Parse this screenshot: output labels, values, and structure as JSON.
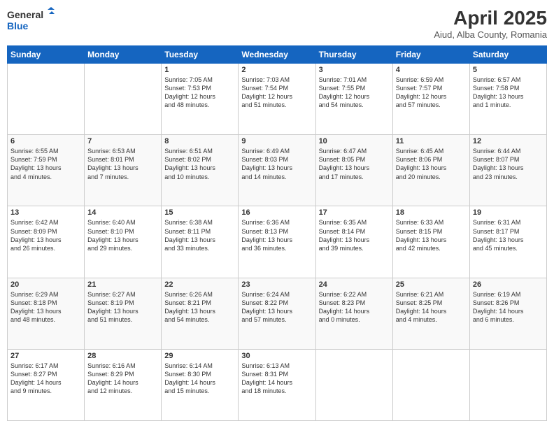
{
  "header": {
    "logo_line1": "General",
    "logo_line2": "Blue",
    "month": "April 2025",
    "location": "Aiud, Alba County, Romania"
  },
  "weekdays": [
    "Sunday",
    "Monday",
    "Tuesday",
    "Wednesday",
    "Thursday",
    "Friday",
    "Saturday"
  ],
  "weeks": [
    [
      {
        "day": "",
        "info": ""
      },
      {
        "day": "",
        "info": ""
      },
      {
        "day": "1",
        "info": "Sunrise: 7:05 AM\nSunset: 7:53 PM\nDaylight: 12 hours\nand 48 minutes."
      },
      {
        "day": "2",
        "info": "Sunrise: 7:03 AM\nSunset: 7:54 PM\nDaylight: 12 hours\nand 51 minutes."
      },
      {
        "day": "3",
        "info": "Sunrise: 7:01 AM\nSunset: 7:55 PM\nDaylight: 12 hours\nand 54 minutes."
      },
      {
        "day": "4",
        "info": "Sunrise: 6:59 AM\nSunset: 7:57 PM\nDaylight: 12 hours\nand 57 minutes."
      },
      {
        "day": "5",
        "info": "Sunrise: 6:57 AM\nSunset: 7:58 PM\nDaylight: 13 hours\nand 1 minute."
      }
    ],
    [
      {
        "day": "6",
        "info": "Sunrise: 6:55 AM\nSunset: 7:59 PM\nDaylight: 13 hours\nand 4 minutes."
      },
      {
        "day": "7",
        "info": "Sunrise: 6:53 AM\nSunset: 8:01 PM\nDaylight: 13 hours\nand 7 minutes."
      },
      {
        "day": "8",
        "info": "Sunrise: 6:51 AM\nSunset: 8:02 PM\nDaylight: 13 hours\nand 10 minutes."
      },
      {
        "day": "9",
        "info": "Sunrise: 6:49 AM\nSunset: 8:03 PM\nDaylight: 13 hours\nand 14 minutes."
      },
      {
        "day": "10",
        "info": "Sunrise: 6:47 AM\nSunset: 8:05 PM\nDaylight: 13 hours\nand 17 minutes."
      },
      {
        "day": "11",
        "info": "Sunrise: 6:45 AM\nSunset: 8:06 PM\nDaylight: 13 hours\nand 20 minutes."
      },
      {
        "day": "12",
        "info": "Sunrise: 6:44 AM\nSunset: 8:07 PM\nDaylight: 13 hours\nand 23 minutes."
      }
    ],
    [
      {
        "day": "13",
        "info": "Sunrise: 6:42 AM\nSunset: 8:09 PM\nDaylight: 13 hours\nand 26 minutes."
      },
      {
        "day": "14",
        "info": "Sunrise: 6:40 AM\nSunset: 8:10 PM\nDaylight: 13 hours\nand 29 minutes."
      },
      {
        "day": "15",
        "info": "Sunrise: 6:38 AM\nSunset: 8:11 PM\nDaylight: 13 hours\nand 33 minutes."
      },
      {
        "day": "16",
        "info": "Sunrise: 6:36 AM\nSunset: 8:13 PM\nDaylight: 13 hours\nand 36 minutes."
      },
      {
        "day": "17",
        "info": "Sunrise: 6:35 AM\nSunset: 8:14 PM\nDaylight: 13 hours\nand 39 minutes."
      },
      {
        "day": "18",
        "info": "Sunrise: 6:33 AM\nSunset: 8:15 PM\nDaylight: 13 hours\nand 42 minutes."
      },
      {
        "day": "19",
        "info": "Sunrise: 6:31 AM\nSunset: 8:17 PM\nDaylight: 13 hours\nand 45 minutes."
      }
    ],
    [
      {
        "day": "20",
        "info": "Sunrise: 6:29 AM\nSunset: 8:18 PM\nDaylight: 13 hours\nand 48 minutes."
      },
      {
        "day": "21",
        "info": "Sunrise: 6:27 AM\nSunset: 8:19 PM\nDaylight: 13 hours\nand 51 minutes."
      },
      {
        "day": "22",
        "info": "Sunrise: 6:26 AM\nSunset: 8:21 PM\nDaylight: 13 hours\nand 54 minutes."
      },
      {
        "day": "23",
        "info": "Sunrise: 6:24 AM\nSunset: 8:22 PM\nDaylight: 13 hours\nand 57 minutes."
      },
      {
        "day": "24",
        "info": "Sunrise: 6:22 AM\nSunset: 8:23 PM\nDaylight: 14 hours\nand 0 minutes."
      },
      {
        "day": "25",
        "info": "Sunrise: 6:21 AM\nSunset: 8:25 PM\nDaylight: 14 hours\nand 4 minutes."
      },
      {
        "day": "26",
        "info": "Sunrise: 6:19 AM\nSunset: 8:26 PM\nDaylight: 14 hours\nand 6 minutes."
      }
    ],
    [
      {
        "day": "27",
        "info": "Sunrise: 6:17 AM\nSunset: 8:27 PM\nDaylight: 14 hours\nand 9 minutes."
      },
      {
        "day": "28",
        "info": "Sunrise: 6:16 AM\nSunset: 8:29 PM\nDaylight: 14 hours\nand 12 minutes."
      },
      {
        "day": "29",
        "info": "Sunrise: 6:14 AM\nSunset: 8:30 PM\nDaylight: 14 hours\nand 15 minutes."
      },
      {
        "day": "30",
        "info": "Sunrise: 6:13 AM\nSunset: 8:31 PM\nDaylight: 14 hours\nand 18 minutes."
      },
      {
        "day": "",
        "info": ""
      },
      {
        "day": "",
        "info": ""
      },
      {
        "day": "",
        "info": ""
      }
    ]
  ]
}
